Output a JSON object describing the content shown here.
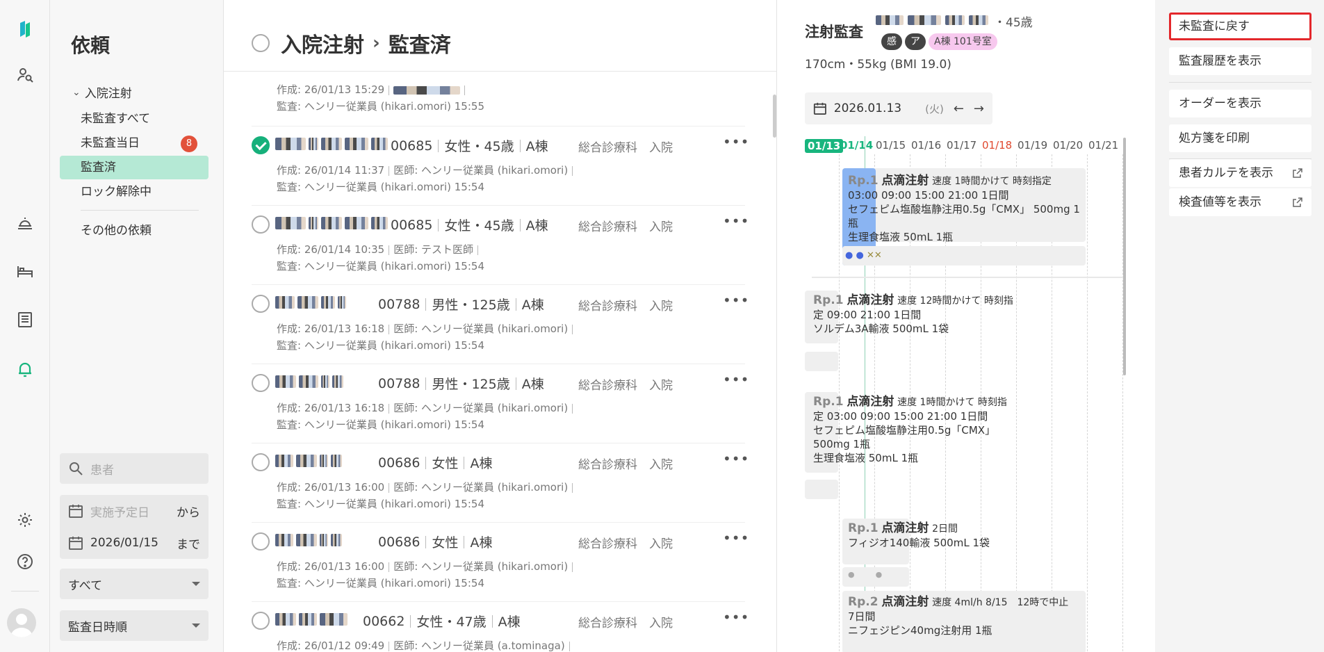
{
  "sidebar": {
    "title": "依頼",
    "group_label": "入院注射",
    "items": [
      {
        "label": "未監査すべて"
      },
      {
        "label": "未監査当日",
        "badge": "8"
      },
      {
        "label": "監査済"
      },
      {
        "label": "ロック解除中"
      },
      {
        "label": "その他の依頼"
      }
    ],
    "patient_search_placeholder": "患者",
    "date_from_placeholder": "実施予定日",
    "date_from_suffix": "から",
    "date_to_value": "2026/01/15",
    "date_to_suffix": "まで",
    "filter_select": "すべて",
    "sort_select": "監査日時順"
  },
  "list": {
    "header_left": "入院注射",
    "header_right": "監査済",
    "partial_row": {
      "meta1_prefix": "作成: 26/01/13 15:29",
      "meta2": "監査: ヘンリー従業員 (hikari.omori) 15:55"
    },
    "rows": [
      {
        "id": "00685",
        "gender_age": "女性・45歳",
        "ward": "A棟",
        "dept": "総合診療科",
        "type": "入院",
        "checked": true,
        "meta1": "作成: 26/01/14 11:37",
        "meta1b": "医師: ヘンリー従業員 (hikari.omori)",
        "meta2": "監査: ヘンリー従業員 (hikari.omori) 15:54"
      },
      {
        "id": "00685",
        "gender_age": "女性・45歳",
        "ward": "A棟",
        "dept": "総合診療科",
        "type": "入院",
        "checked": false,
        "meta1": "作成: 26/01/14 10:35",
        "meta1b": "医師: テスト医師",
        "meta2": "監査: ヘンリー従業員 (hikari.omori) 15:54"
      },
      {
        "id": "00788",
        "gender_age": "男性・125歳",
        "ward": "A棟",
        "dept": "総合診療科",
        "type": "入院",
        "checked": false,
        "meta1": "作成: 26/01/13 16:18",
        "meta1b": "医師: ヘンリー従業員 (hikari.omori)",
        "meta2": "監査: ヘンリー従業員 (hikari.omori) 15:54"
      },
      {
        "id": "00788",
        "gender_age": "男性・125歳",
        "ward": "A棟",
        "dept": "総合診療科",
        "type": "入院",
        "checked": false,
        "meta1": "作成: 26/01/13 16:18",
        "meta1b": "医師: ヘンリー従業員 (hikari.omori)",
        "meta2": "監査: ヘンリー従業員 (hikari.omori) 15:54"
      },
      {
        "id": "00686",
        "gender_age": "女性",
        "ward": "A棟",
        "dept": "総合診療科",
        "type": "入院",
        "checked": false,
        "meta1": "作成: 26/01/13 16:00",
        "meta1b": "医師: ヘンリー従業員 (hikari.omori)",
        "meta2": "監査: ヘンリー従業員 (hikari.omori) 15:54"
      },
      {
        "id": "00686",
        "gender_age": "女性",
        "ward": "A棟",
        "dept": "総合診療科",
        "type": "入院",
        "checked": false,
        "meta1": "作成: 26/01/13 16:00",
        "meta1b": "医師: ヘンリー従業員 (hikari.omori)",
        "meta2": "監査: ヘンリー従業員 (hikari.omori) 15:54"
      },
      {
        "id": "00662",
        "gender_age": "女性・47歳",
        "ward": "A棟",
        "dept": "総合診療科",
        "type": "入院",
        "checked": false,
        "meta1": "作成: 26/01/12 09:49",
        "meta1b": "医師: ヘンリー従業員 (a.tominaga)",
        "meta2": ""
      }
    ]
  },
  "detail": {
    "title": "注射監査",
    "age": "・45歳",
    "tags": [
      "感",
      "ア",
      "A棟 101号室"
    ],
    "body_info": "170cm・55kg (BMI 19.0)",
    "date": "2026.01.13",
    "dow": "(火)",
    "timeline_dates": [
      "01/13",
      "01/14",
      "01/15",
      "01/16",
      "01/17",
      "01/18",
      "01/19",
      "01/20",
      "01/21"
    ],
    "rx": [
      {
        "no": "Rp.1",
        "name": "点滴注射",
        "speed": "速度 1時間かけて 時刻指定",
        "line2": "03:00 09:00 15:00 21:00 1日間",
        "line3": "セフェピム塩酸塩静注用0.5g「CMX」 500mg 1瓶",
        "line4": "生理食塩液 50mL 1瓶"
      },
      {
        "no": "Rp.1",
        "name": "点滴注射",
        "speed": "速度 12時間かけて 時刻指",
        "line2": "定 09:00 21:00 1日間",
        "line3": "ソルデム3A輸液 500mL 1袋"
      },
      {
        "no": "Rp.1",
        "name": "点滴注射",
        "speed": "速度 1時間かけて 時刻指",
        "line2": "定 03:00 09:00 15:00 21:00 1日間",
        "line3": "セフェピム塩酸塩静注用0.5g「CMX」",
        "line4": "500mg 1瓶",
        "line5": "生理食塩液 50mL 1瓶"
      },
      {
        "no": "Rp.1",
        "name": "点滴注射",
        "speed": "2日間",
        "line2": "フィジオ140輸液 500mL 1袋"
      },
      {
        "no": "Rp.2",
        "name": "点滴注射",
        "speed": "速度 4ml/h 8/15　12時で中止",
        "line2": "7日間",
        "line3": "ニフェジピン40mg注射用 1瓶"
      }
    ]
  },
  "actions": [
    {
      "label": "未監査に戻す"
    },
    {
      "label": "監査履歴を表示"
    },
    {
      "label": "オーダーを表示"
    },
    {
      "label": "処方箋を印刷"
    },
    {
      "label": "患者カルテを表示"
    },
    {
      "label": "検査値等を表示"
    }
  ],
  "colors": {
    "accent": "#18b57e",
    "badge": "#e2513a",
    "active_nav": "#b5e9d5",
    "focus_outline": "#e3272b",
    "highlight_rx": "#8ab4f2"
  }
}
